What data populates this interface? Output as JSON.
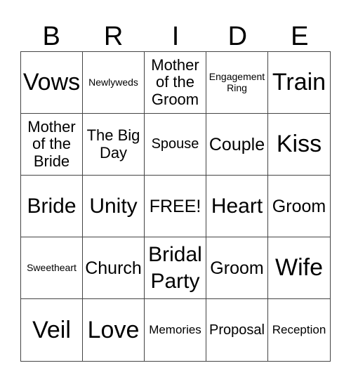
{
  "header": {
    "letters": [
      "B",
      "R",
      "I",
      "D",
      "E"
    ]
  },
  "board": {
    "cells": [
      "Vows",
      "Newlyweds",
      "Mother of the Groom",
      "Engagement Ring",
      "Train",
      "Mother of the Bride",
      "The Big Day",
      "Spouse",
      "Couple",
      "Kiss",
      "Bride",
      "Unity",
      "FREE!",
      "Heart",
      "Groom",
      "Sweetheart",
      "Church",
      "Bridal Party",
      "Groom",
      "Wife",
      "Veil",
      "Love",
      "Memories",
      "Proposal",
      "Reception"
    ]
  }
}
